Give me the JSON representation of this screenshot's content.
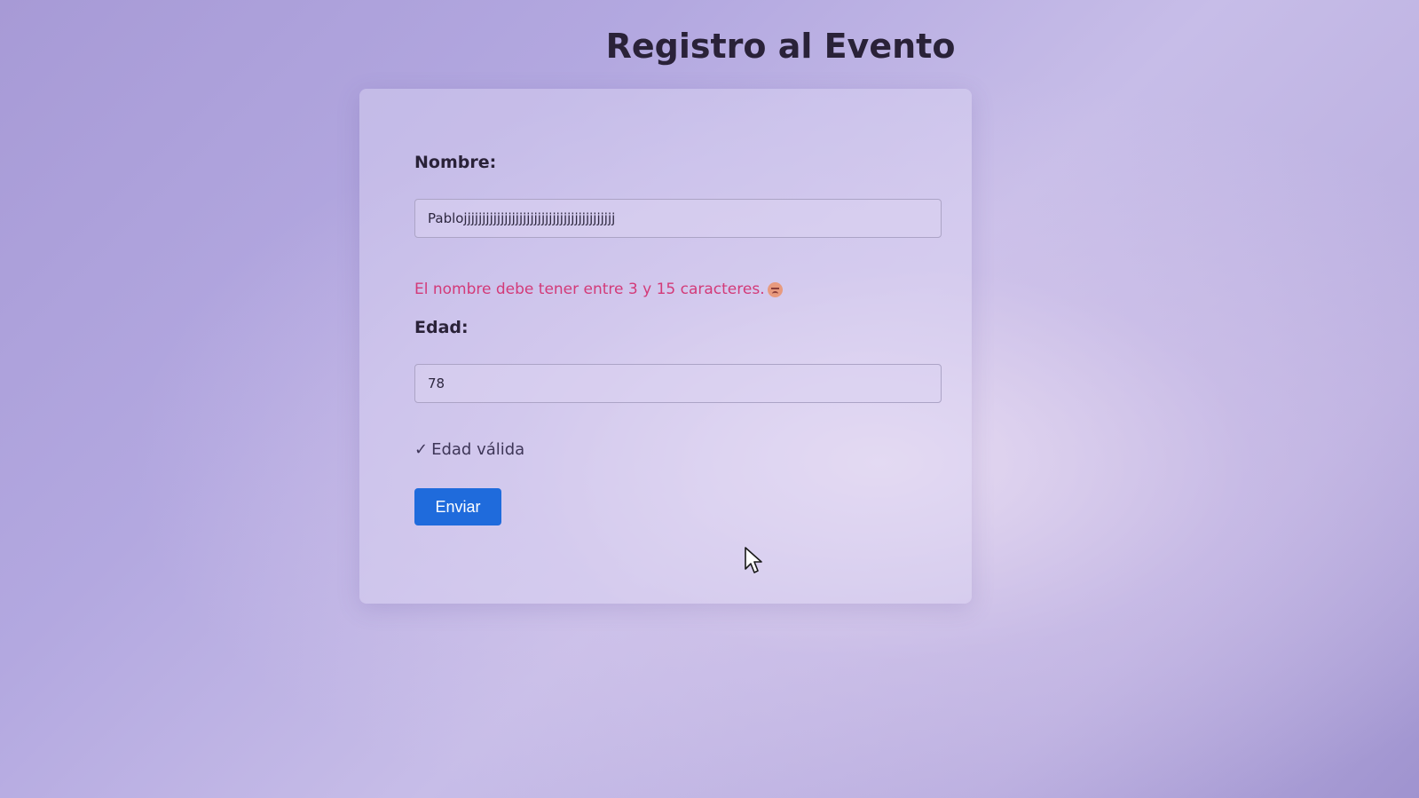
{
  "page": {
    "title": "Registro al Evento"
  },
  "form": {
    "nombre": {
      "label": "Nombre:",
      "value": "Pablojjjjjjjjjjjjjjjjjjjjjjjjjjjjjjjjjjjjjjjjj",
      "error": "El nombre debe tener entre 3 y 15 caracteres."
    },
    "edad": {
      "label": "Edad:",
      "value": "78",
      "status_icon": "✓",
      "status": "Edad válida"
    },
    "submit_label": "Enviar"
  },
  "colors": {
    "accent": "#1f6bdc",
    "error": "#d33a78"
  },
  "icons": {
    "error_icon": "sad-face-icon",
    "valid_icon": "check-icon",
    "pointer": "mouse-cursor-icon"
  }
}
